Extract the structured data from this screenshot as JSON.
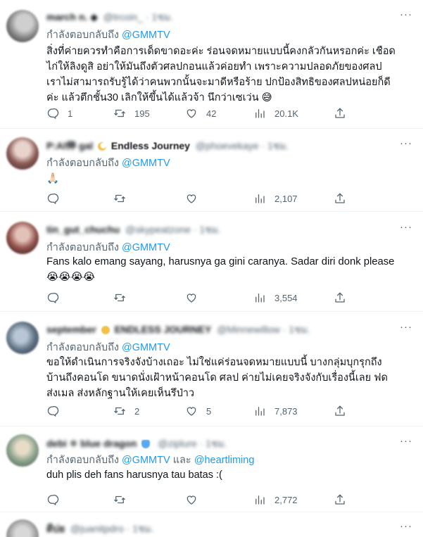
{
  "replying_to_label": "กำลังตอบกลับถึง",
  "and_label": "และ",
  "colors": {
    "accent": "#1d9bf0",
    "secondary_text": "#536471",
    "divider": "#eff3f4"
  },
  "icons": {
    "reply": "reply-icon",
    "retweet": "retweet-icon",
    "like": "heart-icon",
    "views": "views-icon",
    "share": "share-icon",
    "more": "more-icon"
  },
  "tweets": [
    {
      "name": "march n. ◆",
      "handle": "@trcoin_ · 1ชม.",
      "mentions": [
        "@GMMTV"
      ],
      "text": "สิ่งที่ค่ายควรทำคือการเด็ดขาดอะค่ะ ร่อนจดหมายแบบนี้คงกลัวกันหรอกค่ะ เชือดไก่ให้ลิงดูสิ อย่าให้มันถึงตัวศลปกอนแล้วค่อยทำ เพราะความปลอดภัยของศลป เราไม่สามารถรับรู้ได้ว่าคนพวกนั้นจะมาดีหรือร้าย ปกป้องสิทธิของศลปหน่อยก็ดีค่ะ แล้วตึกชั้น30 เลิกให้ขึ้นได้แล้วจ้า นึกว่าเซเว่น 😅",
      "replies": "1",
      "retweets": "195",
      "likes": "42",
      "views": "20.1K"
    },
    {
      "name": "P:Al伸 gal",
      "extra": "Endless Journey",
      "handle": "@phoevekaye · 1ชม.",
      "mentions": [
        "@GMMTV"
      ],
      "text": "🙏🏻",
      "replies": "",
      "retweets": "",
      "likes": "",
      "views": "2,107"
    },
    {
      "name": "tin_gut_chuchu",
      "handle": "@skypeatzone · 1ชม.",
      "mentions": [
        "@GMMTV"
      ],
      "text": "Fans kalo emang sayang, harusnya ga gini caranya. Sadar diri donk please 😭😭😭😭",
      "replies": "",
      "retweets": "",
      "likes": "",
      "views": "3,554"
    },
    {
      "name": "september",
      "extra": "ENDLESS JOURNEY",
      "handle": "@Minnewillow · 1ชม.",
      "mentions": [
        "@GMMTV"
      ],
      "text": "ขอให้ดำเนินการจริงจังบ้างเถอะ ไม่ใช่แค่ร่อนจดหมายแบบนี้ บางกลุ่มบุกรุกถึงบ้านถึงคอนโด ขนาดนั่งเฝ้าหน้าคอนโด ศลป ค่ายไม่เคยจริงจังกับเรื่องนี้เลย ฟด ส่งเมล ส่งหลักฐานให้เคยเห็นรึป่าว",
      "replies": "",
      "retweets": "2",
      "likes": "5",
      "views": "7,873"
    },
    {
      "name": "debi ❄ blue dragon",
      "handle": "@ziplure · 1ชม.",
      "mentions": [
        "@GMMTV",
        "@heartliming"
      ],
      "text": "duh plis deh fans harusnya tau batas :(",
      "replies": "",
      "retweets": "",
      "likes": "",
      "views": "2,772"
    },
    {
      "name": "ดีบ่ย",
      "handle": "@juanitpdro · 1ชม."
    }
  ]
}
